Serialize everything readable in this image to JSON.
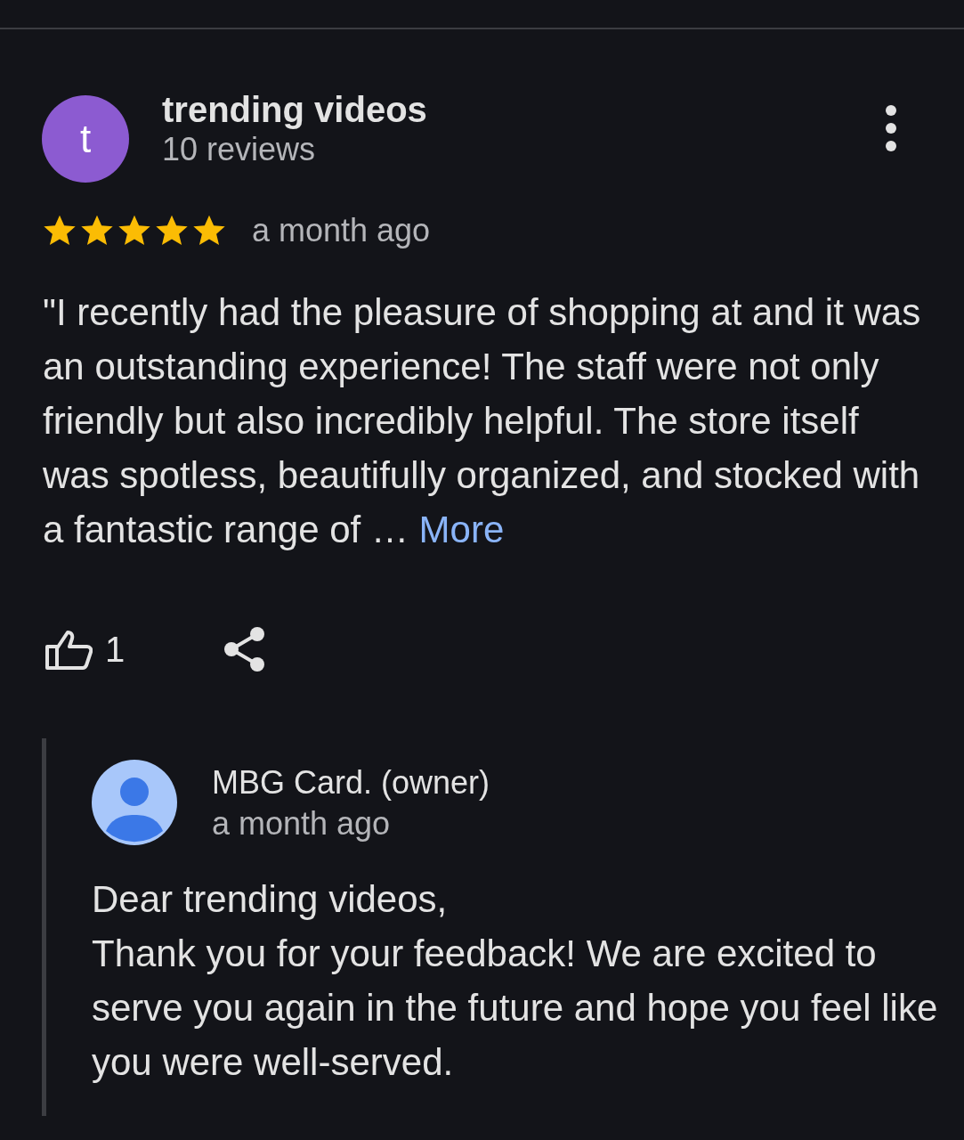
{
  "review": {
    "author": {
      "initial": "t",
      "name": "trending videos",
      "reviews": "10 reviews",
      "color": "#8c5bd1"
    },
    "stars": 5,
    "time": "a month ago",
    "text": "\"I recently had the pleasure of shopping at and it was an outstanding experience! The staff were not only friendly but also incredibly helpful. The store itself was spotless, beautifully organized, and stocked with a fantastic range of …",
    "more": "More",
    "likes": "1"
  },
  "reply": {
    "name": "MBG Card. (owner)",
    "time": "a month ago",
    "greeting": "Dear trending videos,",
    "text": "Thank you for your feedback! We are excited to serve you again in the future and hope you feel like you were well-served."
  }
}
